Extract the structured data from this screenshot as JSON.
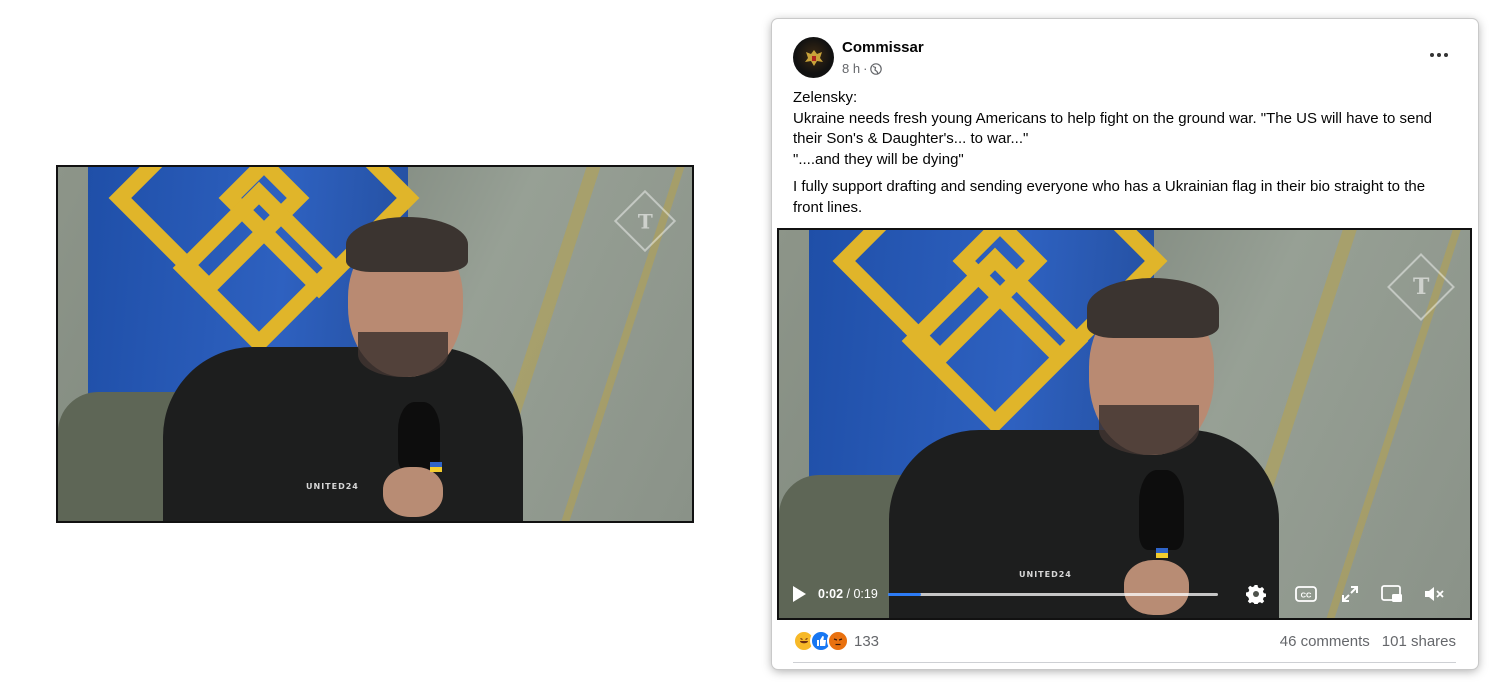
{
  "post": {
    "author": "Commissar",
    "time": "8 h",
    "separator": "·",
    "text_lines": [
      "Zelensky:",
      "Ukraine needs fresh young Americans to help fight on the ground war. \"The US will have to send their Son's & Daughter's... to war...\"",
      "\"....and they will be dying\""
    ],
    "text_para2": "I fully support drafting and sending everyone who has a Ukrainian flag in their bio straight to the front lines."
  },
  "video": {
    "current_time": "0:02",
    "total_time": " / 0:19",
    "progress_fraction": 0.1,
    "shirt_text": "UNITED24",
    "watermark": "T",
    "progress_color": "#2d7cf6"
  },
  "engagement": {
    "reactions": [
      "haha",
      "like",
      "angry"
    ],
    "reaction_count": "133",
    "comments": "46 comments",
    "shares": "101 shares"
  }
}
